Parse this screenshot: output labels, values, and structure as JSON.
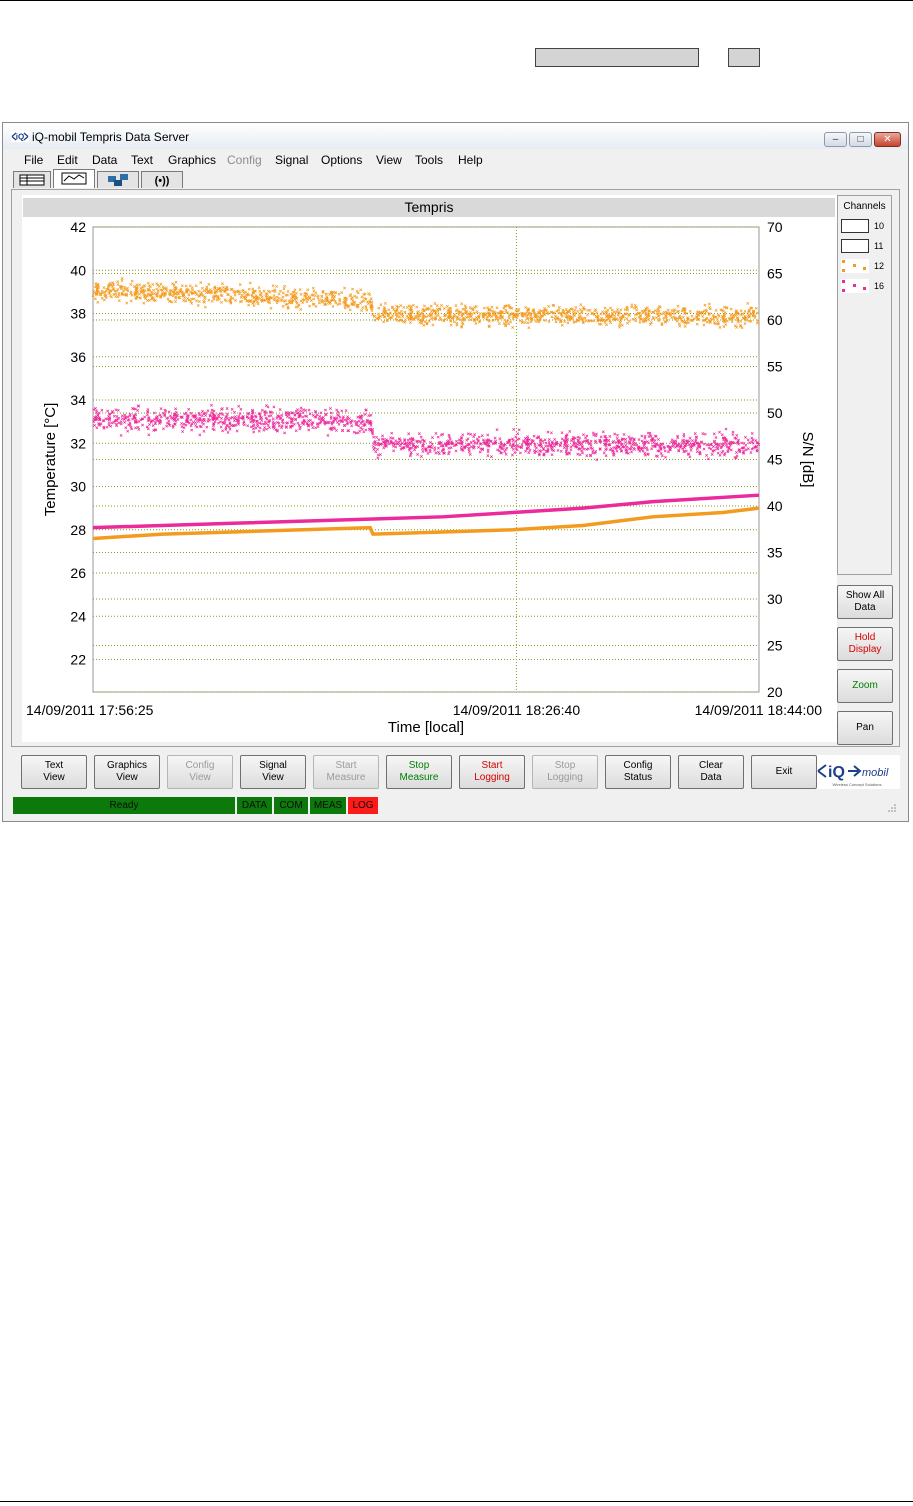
{
  "window": {
    "title": "iQ-mobil Tempris Data Server",
    "minimize": "–",
    "maximize": "□",
    "close": "✕"
  },
  "menu": [
    {
      "label": "File",
      "enabled": true
    },
    {
      "label": "Edit",
      "enabled": true
    },
    {
      "label": "Data",
      "enabled": true
    },
    {
      "label": "Text",
      "enabled": true
    },
    {
      "label": "Graphics",
      "enabled": true
    },
    {
      "label": "Config",
      "enabled": false
    },
    {
      "label": "Signal",
      "enabled": true
    },
    {
      "label": "Options",
      "enabled": true
    },
    {
      "label": "View",
      "enabled": true
    },
    {
      "label": "Tools",
      "enabled": true
    },
    {
      "label": "Help",
      "enabled": true
    }
  ],
  "tabs": [
    {
      "icon": "table-view-icon",
      "active": false
    },
    {
      "icon": "graph-view-icon",
      "active": true
    },
    {
      "icon": "network-config-icon",
      "active": false
    },
    {
      "icon": "signal-icon",
      "active": false
    }
  ],
  "channels": {
    "title": "Channels",
    "items": [
      {
        "label": "10",
        "color": "#ffffff"
      },
      {
        "label": "11",
        "color": "#ffffff"
      },
      {
        "label": "12",
        "color": "#f39b1f"
      },
      {
        "label": "16",
        "color": "#ec2a9c"
      }
    ]
  },
  "side_buttons": [
    {
      "label": "Show All\nData",
      "color": "#000000"
    },
    {
      "label": "Hold\nDisplay",
      "color": "#d40000"
    },
    {
      "label": "Zoom",
      "color": "#008000"
    },
    {
      "label": "Pan",
      "color": "#000000"
    }
  ],
  "bottom_buttons": [
    {
      "label": "Text\nView",
      "enabled": true,
      "color": "#000000"
    },
    {
      "label": "Graphics\nView",
      "enabled": true,
      "color": "#000000"
    },
    {
      "label": "Config\nView",
      "enabled": false,
      "color": "#9a9a9a"
    },
    {
      "label": "Signal\nView",
      "enabled": true,
      "color": "#000000"
    },
    {
      "label": "Start\nMeasure",
      "enabled": false,
      "color": "#9a9a9a"
    },
    {
      "label": "Stop\nMeasure",
      "enabled": true,
      "color": "#008000"
    },
    {
      "label": "Start\nLogging",
      "enabled": true,
      "color": "#d40000"
    },
    {
      "label": "Stop\nLogging",
      "enabled": false,
      "color": "#9a9a9a"
    },
    {
      "label": "Config\nStatus",
      "enabled": true,
      "color": "#000000"
    },
    {
      "label": "Clear\nData",
      "enabled": true,
      "color": "#000000"
    },
    {
      "label": "Exit",
      "enabled": true,
      "color": "#000000"
    }
  ],
  "logo": {
    "text": "iQ",
    "sub": "mobil",
    "tagline": "Wireless Concept Solutions"
  },
  "status": {
    "ready": "Ready",
    "indicators": [
      {
        "label": "DATA",
        "color": "#0b7a0b"
      },
      {
        "label": "COM",
        "color": "#0b7a0b"
      },
      {
        "label": "MEAS",
        "color": "#0b7a0b"
      },
      {
        "label": "LOG",
        "color": "#ff1a1a"
      }
    ]
  },
  "chart_data": {
    "type": "scatter",
    "title": "Tempris",
    "xlabel": "Time [local]",
    "ylabel_left": "Temperature [°C]",
    "ylabel_right": "S/N [dB]",
    "x_tick_labels": [
      "14/09/2011 17:56:25",
      "14/09/2011 18:26:40",
      "14/09/2011 18:44:00"
    ],
    "xlim_minutes": [
      0,
      47.58
    ],
    "ylim_left": [
      20.5,
      42
    ],
    "ylim_right": [
      20,
      70
    ],
    "y_ticks_left": [
      22,
      24,
      26,
      28,
      30,
      32,
      34,
      36,
      38,
      40,
      42
    ],
    "y_ticks_right": [
      20,
      25,
      30,
      35,
      40,
      45,
      50,
      55,
      60,
      65,
      70
    ],
    "grid": true,
    "series": [
      {
        "name": "12",
        "kind": "temperature line",
        "axis": "left",
        "color": "#f39b1f",
        "x": [
          0,
          5,
          10,
          15,
          19.8,
          20,
          25,
          30,
          35,
          40,
          45,
          47.58
        ],
        "y": [
          27.6,
          27.8,
          27.9,
          28.0,
          28.1,
          27.8,
          27.9,
          28.0,
          28.2,
          28.6,
          28.8,
          29.0
        ]
      },
      {
        "name": "16",
        "kind": "temperature line",
        "axis": "left",
        "color": "#ec2a9c",
        "x": [
          0,
          10,
          20,
          25,
          30,
          35,
          40,
          47.58
        ],
        "y": [
          28.1,
          28.3,
          28.5,
          28.6,
          28.8,
          29.0,
          29.3,
          29.6
        ]
      },
      {
        "name": "12",
        "kind": "S/N scatter",
        "axis": "right",
        "color": "#f39b1f",
        "x": [
          0,
          19.8,
          20.1,
          47.58
        ],
        "y_mean": [
          63.2,
          62.2,
          60.6,
          60.4
        ],
        "y_spread": 1.2
      },
      {
        "name": "16",
        "kind": "S/N scatter",
        "axis": "right",
        "color": "#ec2a9c",
        "x": [
          0,
          19.8,
          20.1,
          47.58
        ],
        "y_mean": [
          49.3,
          49.2,
          46.6,
          46.6
        ],
        "y_spread": 1.4
      }
    ]
  }
}
